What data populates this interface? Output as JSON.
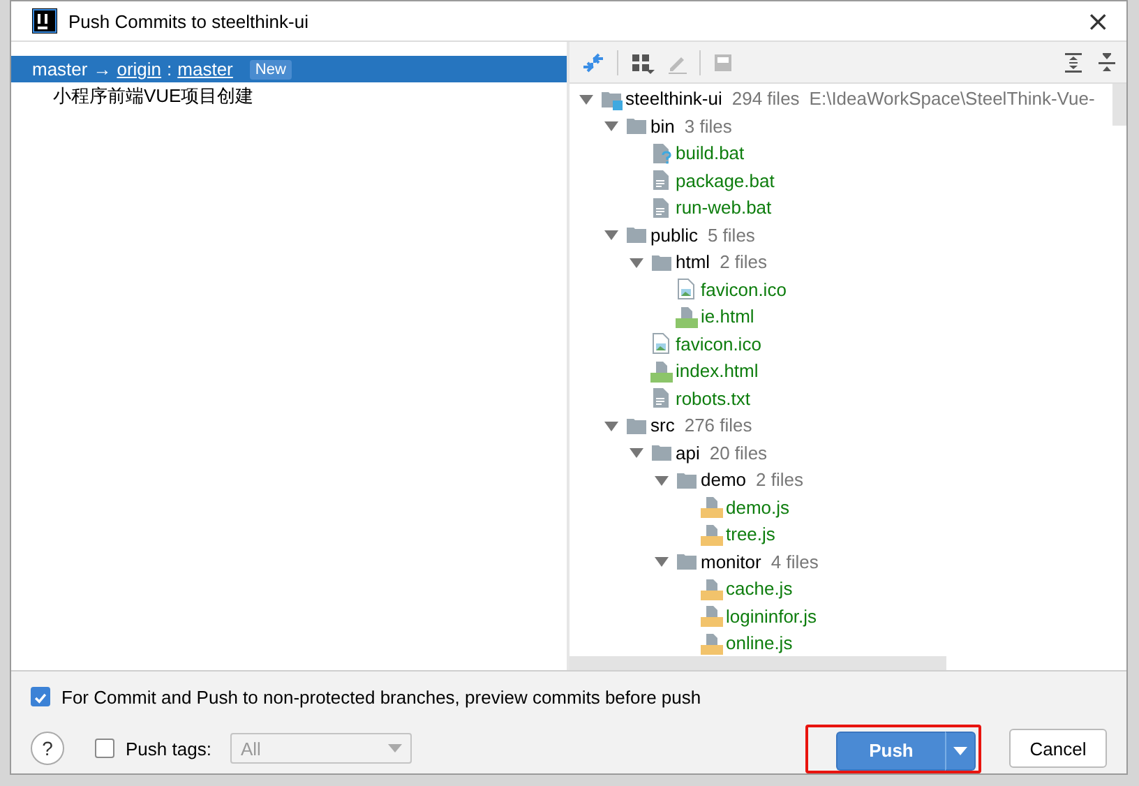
{
  "window": {
    "title": "Push Commits to steelthink-ui",
    "close": "×"
  },
  "branches": [
    {
      "source": "master",
      "arrow": "→",
      "remote": "origin",
      "separator": ":",
      "target": "master",
      "badge": "New",
      "selected": true,
      "commits": [
        {
          "message": "小程序前端VUE项目创建",
          "selected": false
        }
      ]
    }
  ],
  "tree": [
    {
      "kind": "module",
      "name": "steelthink-ui",
      "count": "294 files",
      "path": "E:\\IdeaWorkSpace\\SteelThink-Vue-",
      "expanded": true,
      "children": [
        {
          "kind": "folder",
          "name": "bin",
          "count": "3 files",
          "expanded": true,
          "children": [
            {
              "kind": "unknown",
              "name": "build.bat"
            },
            {
              "kind": "text",
              "name": "package.bat"
            },
            {
              "kind": "text",
              "name": "run-web.bat"
            }
          ]
        },
        {
          "kind": "folder",
          "name": "public",
          "count": "5 files",
          "expanded": true,
          "children": [
            {
              "kind": "folder",
              "name": "html",
              "count": "2 files",
              "expanded": true,
              "children": [
                {
                  "kind": "image",
                  "name": "favicon.ico"
                },
                {
                  "kind": "html",
                  "name": "ie.html"
                }
              ]
            },
            {
              "kind": "image",
              "name": "favicon.ico"
            },
            {
              "kind": "html",
              "name": "index.html"
            },
            {
              "kind": "text",
              "name": "robots.txt"
            }
          ]
        },
        {
          "kind": "folder",
          "name": "src",
          "count": "276 files",
          "expanded": true,
          "children": [
            {
              "kind": "folder",
              "name": "api",
              "count": "20 files",
              "expanded": true,
              "children": [
                {
                  "kind": "folder",
                  "name": "demo",
                  "count": "2 files",
                  "expanded": true,
                  "children": [
                    {
                      "kind": "js",
                      "name": "demo.js"
                    },
                    {
                      "kind": "js",
                      "name": "tree.js"
                    }
                  ]
                },
                {
                  "kind": "folder",
                  "name": "monitor",
                  "count": "4 files",
                  "expanded": true,
                  "children": [
                    {
                      "kind": "js",
                      "name": "cache.js"
                    },
                    {
                      "kind": "js",
                      "name": "logininfor.js"
                    },
                    {
                      "kind": "js",
                      "name": "online.js"
                    }
                  ]
                }
              ]
            }
          ]
        }
      ]
    }
  ],
  "footer": {
    "preview": {
      "label": "For Commit and Push to non-protected branches, preview commits before push",
      "checked": true
    },
    "help": "?",
    "push_tags": {
      "label": "Push tags:",
      "checked": false,
      "value": "All",
      "disabled": true
    },
    "push_button": {
      "label": "Push",
      "highlighted": true
    },
    "cancel_button": {
      "label": "Cancel"
    }
  }
}
